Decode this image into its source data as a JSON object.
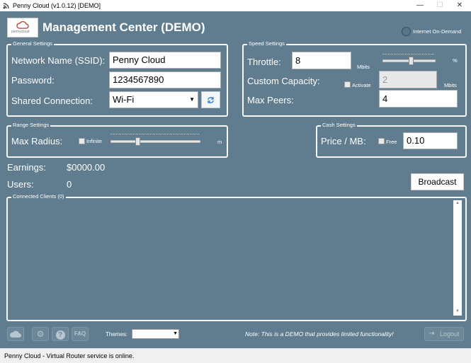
{
  "window": {
    "title": "Penny Cloud (v1.0.12) [DEMO]",
    "minimize": "—",
    "maximize": "☐",
    "close": "✕"
  },
  "header": {
    "logo_text": "pennycloud",
    "title": "Management Center (DEMO)",
    "internet_toggle_label": "Internet On-Demand"
  },
  "general": {
    "title": "General Settings",
    "ssid_label": "Network Name (SSID):",
    "ssid_value": "Penny Cloud",
    "password_label": "Password:",
    "password_value": "1234567890",
    "shared_label": "Shared Connection:",
    "shared_value": "Wi-Fi"
  },
  "speed": {
    "title": "Speed Settings",
    "throttle_label": "Throttle:",
    "throttle_value": "8",
    "throttle_unit": "Mbits",
    "percent_unit": "%",
    "throttle_slider_level": 0.55,
    "capacity_label": "Custom Capacity:",
    "activate_label": "Activate",
    "capacity_value": "2",
    "capacity_unit": "Mbits",
    "peers_label": "Max Peers:",
    "peers_value": "4"
  },
  "range": {
    "title": "Range Settings",
    "radius_label": "Max Radius:",
    "infinite_label": "Infinite",
    "unit": "m",
    "slider_level": 0.3
  },
  "cash": {
    "title": "Cash Settings",
    "price_label": "Price / MB:",
    "free_label": "Free",
    "price_value": "0.10"
  },
  "stats": {
    "earnings_label": "Earnings:",
    "earnings_value": "$0000.00",
    "users_label": "Users:",
    "users_value": "0"
  },
  "broadcast_label": "Broadcast",
  "clients": {
    "title": "Connected Clients (0)"
  },
  "footer": {
    "faq_label": "FAQ",
    "themes_label": "Themes:",
    "themes_value": "",
    "note": "Note: This is a DEMO that provides limited functionality!",
    "logout_label": "Logout"
  },
  "status": "Penny Cloud - Virtual Router service is online.",
  "colors": {
    "background": "#5f7d8e",
    "group_border": "#f4f6f7",
    "logo_red": "#c0392b"
  }
}
